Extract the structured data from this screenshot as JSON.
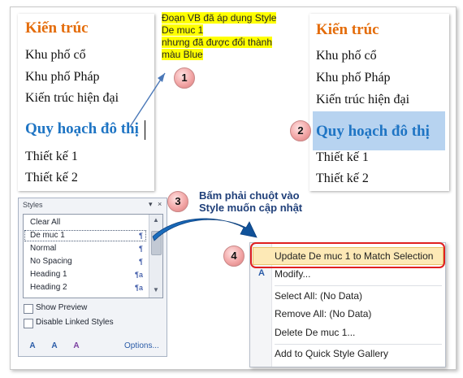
{
  "document_before": {
    "heading1": "Kiến trúc",
    "lines": [
      "Khu phố cổ",
      "Khu phố Pháp",
      "Kiến trúc hiện đại"
    ],
    "heading2": "Quy hoạch đô thị",
    "lines_after": [
      "Thiết kế 1",
      "Thiết kế 2"
    ]
  },
  "document_after": {
    "heading1": "Kiến trúc",
    "lines": [
      "Khu phố cổ",
      "Khu phố Pháp",
      "Kiến trúc hiện đại"
    ],
    "heading2": "Quy hoạch đô thị",
    "lines_after": [
      "Thiết kế 1",
      "Thiết kế 2"
    ]
  },
  "note_lines": [
    "Đoạn VB đã áp dụng Style",
    "De muc 1",
    "nhưng đã được đổi thành",
    "màu Blue"
  ],
  "instruction_lines": [
    "Bấm phải chuột vào",
    "Style muốn cập nhật"
  ],
  "steps": [
    "1",
    "2",
    "3",
    "4"
  ],
  "styles_pane": {
    "title": "Styles",
    "controls": [
      "▾",
      "×"
    ],
    "items": [
      {
        "label": "Clear All",
        "mark": ""
      },
      {
        "label": "De muc 1",
        "mark": "¶"
      },
      {
        "label": "Normal",
        "mark": "¶"
      },
      {
        "label": "No Spacing",
        "mark": "¶"
      },
      {
        "label": "Heading 1",
        "mark": "¶a"
      },
      {
        "label": "Heading 2",
        "mark": "¶a"
      }
    ],
    "show_preview": "Show Preview",
    "disable_linked": "Disable Linked Styles",
    "buttons": [
      "A",
      "A",
      "A"
    ],
    "options": "Options..."
  },
  "context_menu": {
    "update": "Update De muc 1 to Match Selection",
    "modify": "Modify...",
    "select_all": "Select All: (No Data)",
    "remove_all": "Remove All: (No Data)",
    "delete": "Delete De muc 1...",
    "add_gallery": "Add to Quick Style Gallery"
  },
  "colors": {
    "heading1": "#e46c0a",
    "heading2": "#1f75c4",
    "highlight_selection": "#b7d3f0",
    "menu_highlight": "#fde9b6",
    "red_ring": "#e02020",
    "note_highlight": "#ffff00"
  }
}
